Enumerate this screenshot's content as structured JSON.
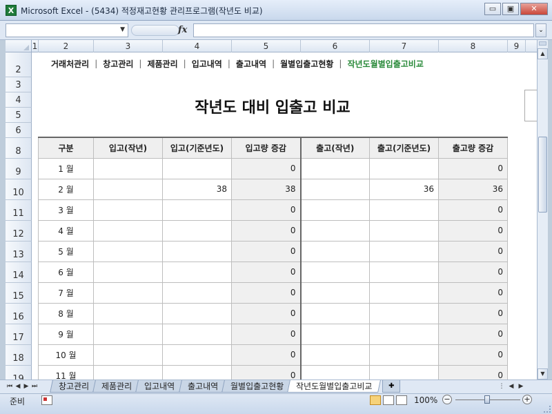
{
  "window": {
    "title": "Microsoft Excel - (5434) 적정재고현황 관리프로그램(작년도 비교)",
    "icon_label": "X",
    "minimize_glyph": "▭",
    "restore_glyph": "▣",
    "close_glyph": "✕"
  },
  "formula_bar": {
    "name_box_value": "",
    "fx_label": "fx",
    "formula_value": ""
  },
  "columns": [
    "1",
    "2",
    "3",
    "4",
    "5",
    "6",
    "7",
    "8",
    "9"
  ],
  "rows": [
    "2",
    "3",
    "4",
    "5",
    "6",
    "8",
    "9",
    "10",
    "11",
    "12",
    "13",
    "14",
    "15",
    "16",
    "17",
    "18",
    "19"
  ],
  "nav": {
    "items": [
      {
        "label": "거래처관리"
      },
      {
        "label": "창고관리"
      },
      {
        "label": "제품관리"
      },
      {
        "label": "입고내역"
      },
      {
        "label": "출고내역"
      },
      {
        "label": "월별입출고현황"
      },
      {
        "label": "작년도월별입출고비교"
      }
    ],
    "separator": "|",
    "active_index": 6
  },
  "page_title": "작년도 대비 입출고 비교",
  "table": {
    "headers": [
      "구분",
      "입고(작년)",
      "입고(기준년도)",
      "입고량 증감",
      "출고(작년)",
      "출고(기준년도)",
      "출고량 증감"
    ],
    "rows": [
      {
        "month": "1 월",
        "in_prev": "",
        "in_cur": "",
        "in_diff": "0",
        "out_prev": "",
        "out_cur": "",
        "out_diff": "0"
      },
      {
        "month": "2 월",
        "in_prev": "",
        "in_cur": "38",
        "in_diff": "38",
        "out_prev": "",
        "out_cur": "36",
        "out_diff": "36"
      },
      {
        "month": "3 월",
        "in_prev": "",
        "in_cur": "",
        "in_diff": "0",
        "out_prev": "",
        "out_cur": "",
        "out_diff": "0"
      },
      {
        "month": "4 월",
        "in_prev": "",
        "in_cur": "",
        "in_diff": "0",
        "out_prev": "",
        "out_cur": "",
        "out_diff": "0"
      },
      {
        "month": "5 월",
        "in_prev": "",
        "in_cur": "",
        "in_diff": "0",
        "out_prev": "",
        "out_cur": "",
        "out_diff": "0"
      },
      {
        "month": "6 월",
        "in_prev": "",
        "in_cur": "",
        "in_diff": "0",
        "out_prev": "",
        "out_cur": "",
        "out_diff": "0"
      },
      {
        "month": "7 월",
        "in_prev": "",
        "in_cur": "",
        "in_diff": "0",
        "out_prev": "",
        "out_cur": "",
        "out_diff": "0"
      },
      {
        "month": "8 월",
        "in_prev": "",
        "in_cur": "",
        "in_diff": "0",
        "out_prev": "",
        "out_cur": "",
        "out_diff": "0"
      },
      {
        "month": "9 월",
        "in_prev": "",
        "in_cur": "",
        "in_diff": "0",
        "out_prev": "",
        "out_cur": "",
        "out_diff": "0"
      },
      {
        "month": "10 월",
        "in_prev": "",
        "in_cur": "",
        "in_diff": "0",
        "out_prev": "",
        "out_cur": "",
        "out_diff": "0"
      },
      {
        "month": "11 월",
        "in_prev": "",
        "in_cur": "",
        "in_diff": "0",
        "out_prev": "",
        "out_cur": "",
        "out_diff": "0"
      }
    ]
  },
  "sheet_tabs": {
    "tabs": [
      {
        "label": "창고관리"
      },
      {
        "label": "제품관리"
      },
      {
        "label": "입고내역"
      },
      {
        "label": "출고내역"
      },
      {
        "label": "월별입출고현황"
      },
      {
        "label": "작년도월별입출고비교"
      }
    ],
    "active_index": 5
  },
  "status": {
    "ready_text": "준비",
    "zoom_level": "100%",
    "zoom_minus": "−",
    "zoom_plus": "+"
  },
  "colors": {
    "active_nav": "#2a8a3a",
    "excel_green": "#1f7a3a"
  }
}
